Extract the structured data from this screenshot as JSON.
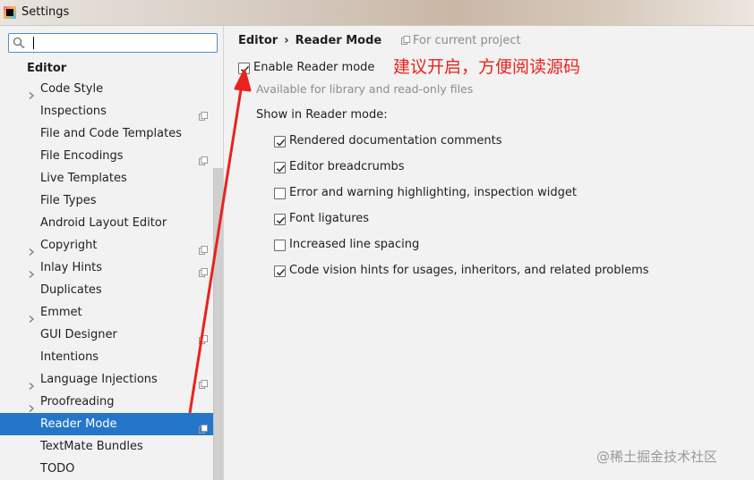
{
  "window": {
    "title": "Settings"
  },
  "search": {
    "value": "",
    "placeholder": ""
  },
  "sidebar": {
    "section": "Editor",
    "items": [
      {
        "label": "Code Style",
        "expandable": true,
        "project_icon": false
      },
      {
        "label": "Inspections",
        "expandable": false,
        "project_icon": true
      },
      {
        "label": "File and Code Templates",
        "expandable": false,
        "project_icon": false
      },
      {
        "label": "File Encodings",
        "expandable": false,
        "project_icon": true
      },
      {
        "label": "Live Templates",
        "expandable": false,
        "project_icon": false
      },
      {
        "label": "File Types",
        "expandable": false,
        "project_icon": false
      },
      {
        "label": "Android Layout Editor",
        "expandable": false,
        "project_icon": false
      },
      {
        "label": "Copyright",
        "expandable": true,
        "project_icon": true
      },
      {
        "label": "Inlay Hints",
        "expandable": true,
        "project_icon": true
      },
      {
        "label": "Duplicates",
        "expandable": false,
        "project_icon": false
      },
      {
        "label": "Emmet",
        "expandable": true,
        "project_icon": false
      },
      {
        "label": "GUI Designer",
        "expandable": false,
        "project_icon": true
      },
      {
        "label": "Intentions",
        "expandable": false,
        "project_icon": false
      },
      {
        "label": "Language Injections",
        "expandable": true,
        "project_icon": true
      },
      {
        "label": "Proofreading",
        "expandable": true,
        "project_icon": false
      },
      {
        "label": "Reader Mode",
        "expandable": false,
        "project_icon": true,
        "selected": true
      },
      {
        "label": "TextMate Bundles",
        "expandable": false,
        "project_icon": false
      },
      {
        "label": "TODO",
        "expandable": false,
        "project_icon": false
      }
    ]
  },
  "breadcrumb": {
    "parent": "Editor",
    "separator": "›",
    "current": "Reader Mode"
  },
  "project_scope": {
    "label": "For current project",
    "icon": "copy-icon"
  },
  "enable": {
    "label": "Enable Reader mode",
    "checked": true
  },
  "annotation": {
    "text": "建议开启，方便阅读源码",
    "color": "#e8231d"
  },
  "hint": "Available for library and read-only files",
  "show_label": "Show in Reader mode:",
  "options": [
    {
      "label": "Rendered documentation comments",
      "checked": true
    },
    {
      "label": "Editor breadcrumbs",
      "checked": true
    },
    {
      "label": "Error and warning highlighting, inspection widget",
      "checked": false
    },
    {
      "label": "Font ligatures",
      "checked": true
    },
    {
      "label": "Increased line spacing",
      "checked": false
    },
    {
      "label": "Code vision hints for usages, inheritors, and related problems",
      "checked": true
    }
  ],
  "watermark": "@稀土掘金技术社区",
  "colors": {
    "accent": "#2477c8",
    "annotation": "#e8231d",
    "focus": "#4a8fd9"
  }
}
